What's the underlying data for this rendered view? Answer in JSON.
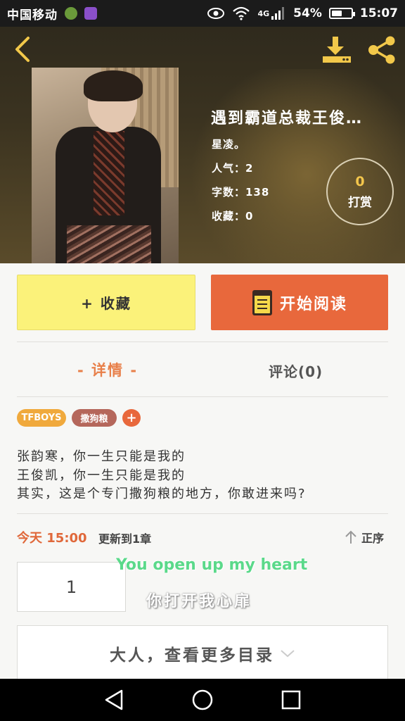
{
  "status_bar": {
    "carrier": "中国移动",
    "network": "4G",
    "battery": "54%",
    "battery_level": 0.54,
    "time": "15:07"
  },
  "header": {
    "title": "遇到霸道总裁王俊…",
    "author": "星凌。",
    "popularity": "人气：2",
    "word_count": "字数：138",
    "favorites": "收藏：0",
    "reward_count": "0",
    "reward_label": "打赏"
  },
  "actions": {
    "favorite_label": "+ 收藏",
    "read_label": "开始阅读"
  },
  "tabs": {
    "detail": "- 详情 -",
    "comments": "评论(0)"
  },
  "tags": [
    {
      "label": "TFBOYS",
      "color": "#f0a93c"
    },
    {
      "label": "撒狗粮",
      "color": "#b5675b"
    }
  ],
  "tag_add": "+",
  "description": [
    "张韵寒，你一生只能是我的",
    "王俊凯，你一生只能是我的",
    "其实，这是个专门撒狗粮的地方，你敢进来吗?"
  ],
  "update": {
    "today": "今天 15:00",
    "text": "更新到1章",
    "sort_label": "正序"
  },
  "chapter_number": "1",
  "watermark": {
    "line1": "You open up my heart",
    "line2": "你打开我心扉"
  },
  "more_catalog": "大人，查看更多目录",
  "colors": {
    "accent_orange": "#e8683c",
    "favorite_yellow": "#fbf27a",
    "reward_gold": "#f3c64c"
  }
}
